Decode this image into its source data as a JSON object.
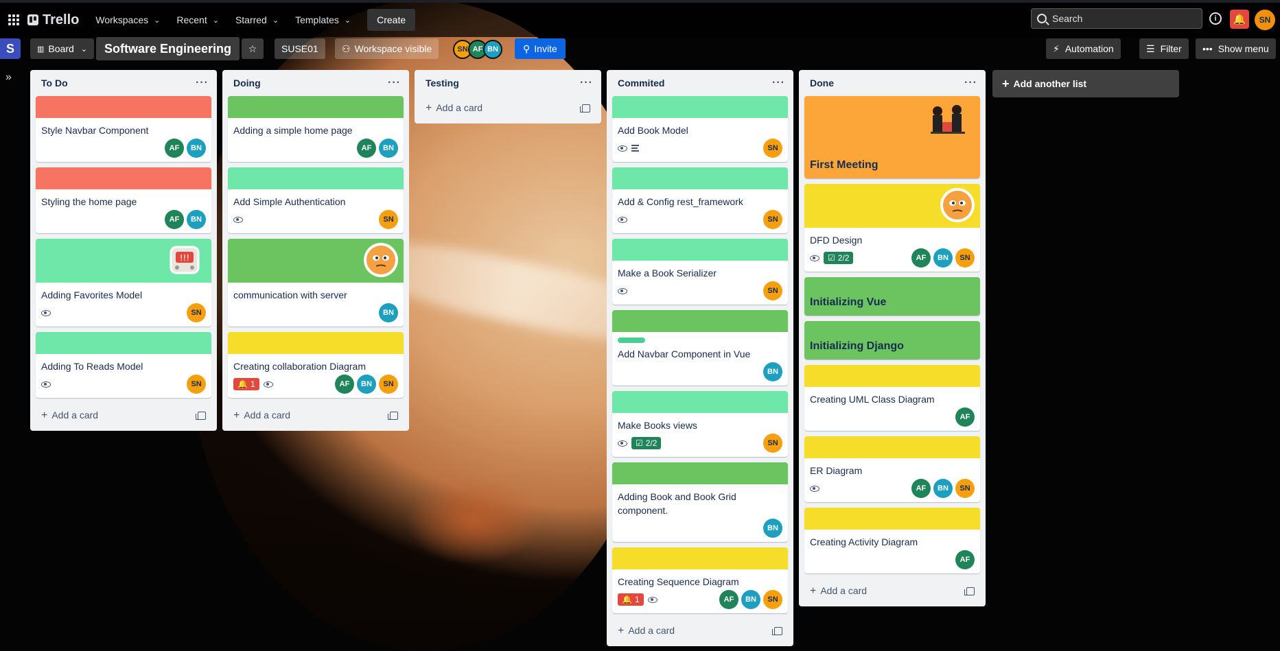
{
  "nav": {
    "logo": "Trello",
    "menus": [
      "Workspaces",
      "Recent",
      "Starred",
      "Templates"
    ],
    "create": "Create",
    "search_placeholder": "Search",
    "user_initials": "SN"
  },
  "board": {
    "workspace_initial": "S",
    "view": "Board",
    "title": "Software Engineering",
    "workspace_name": "SUSE01",
    "visibility": "Workspace visible",
    "members": [
      "SN",
      "AF",
      "BN"
    ],
    "invite": "Invite",
    "automation": "Automation",
    "filter": "Filter",
    "show_menu": "Show menu",
    "add_list": "Add another list",
    "add_card": "Add a card"
  },
  "colors": {
    "red": "#f87462",
    "green": "#6cc461",
    "lightgreen": "#6ee7a8",
    "yellow": "#f5dd29",
    "orange": "#fca63a"
  },
  "lists": [
    {
      "name": "To Do",
      "cards": [
        {
          "title": "Style Navbar Component",
          "cover": "red",
          "members": [
            "AF",
            "BN"
          ]
        },
        {
          "title": "Styling the home page",
          "cover": "red",
          "members": [
            "AF",
            "BN"
          ]
        },
        {
          "title": "Adding Favorites Model",
          "cover": "lightgreen",
          "sticker": "robot",
          "watch": true,
          "members": [
            "SN"
          ]
        },
        {
          "title": "Adding To Reads Model",
          "cover": "lightgreen",
          "watch": true,
          "members": [
            "SN"
          ]
        }
      ]
    },
    {
      "name": "Doing",
      "cards": [
        {
          "title": "Adding a simple home page",
          "cover": "green",
          "members": [
            "AF",
            "BN"
          ]
        },
        {
          "title": "Add Simple Authentication",
          "cover": "lightgreen",
          "watch": true,
          "members": [
            "SN"
          ]
        },
        {
          "title": "communication with server",
          "cover": "green",
          "sticker": "face",
          "members": [
            "BN"
          ]
        },
        {
          "title": "Creating collaboration Diagram",
          "cover": "yellow",
          "alert": "1",
          "watch": true,
          "members": [
            "AF",
            "BN",
            "SN"
          ]
        }
      ]
    },
    {
      "name": "Testing",
      "cards": []
    },
    {
      "name": "Commited",
      "cards": [
        {
          "title": "Add Book Model",
          "cover": "lightgreen",
          "watch": true,
          "description": true,
          "members": [
            "SN"
          ]
        },
        {
          "title": "Add & Config rest_framework",
          "cover": "lightgreen",
          "watch": true,
          "members": [
            "SN"
          ]
        },
        {
          "title": "Make a Book Serializer",
          "cover": "lightgreen",
          "watch": true,
          "members": [
            "SN"
          ]
        },
        {
          "title": "Add Navbar Component in Vue",
          "cover": "green",
          "label": true,
          "members": [
            "BN"
          ]
        },
        {
          "title": "Make Books views",
          "cover": "lightgreen",
          "watch": true,
          "checklist": "2/2",
          "members": [
            "SN"
          ]
        },
        {
          "title": "Adding Book and Book Grid component.",
          "cover": "green",
          "members": [
            "BN"
          ]
        },
        {
          "title": "Creating Sequence Diagram",
          "cover": "yellow",
          "alert": "1",
          "watch": true,
          "members": [
            "AF",
            "BN",
            "SN"
          ]
        }
      ]
    },
    {
      "name": "Done",
      "cards": [
        {
          "title": "First Meeting",
          "cover": "orange",
          "full": true,
          "sticker": "people"
        },
        {
          "title": "DFD Design",
          "cover": "yellow",
          "sticker": "face",
          "watch": true,
          "checklist": "2/2",
          "members": [
            "AF",
            "BN",
            "SN"
          ]
        },
        {
          "title": "Initializing Vue",
          "cover": "green",
          "full": true
        },
        {
          "title": "Initializing Django",
          "cover": "green",
          "full": true
        },
        {
          "title": "Creating UML Class Diagram",
          "cover": "yellow",
          "members": [
            "AF"
          ]
        },
        {
          "title": "ER Diagram",
          "cover": "yellow",
          "watch": true,
          "members": [
            "AF",
            "BN",
            "SN"
          ]
        },
        {
          "title": "Creating Activity Diagram",
          "cover": "yellow",
          "members": [
            "AF"
          ]
        }
      ]
    }
  ]
}
